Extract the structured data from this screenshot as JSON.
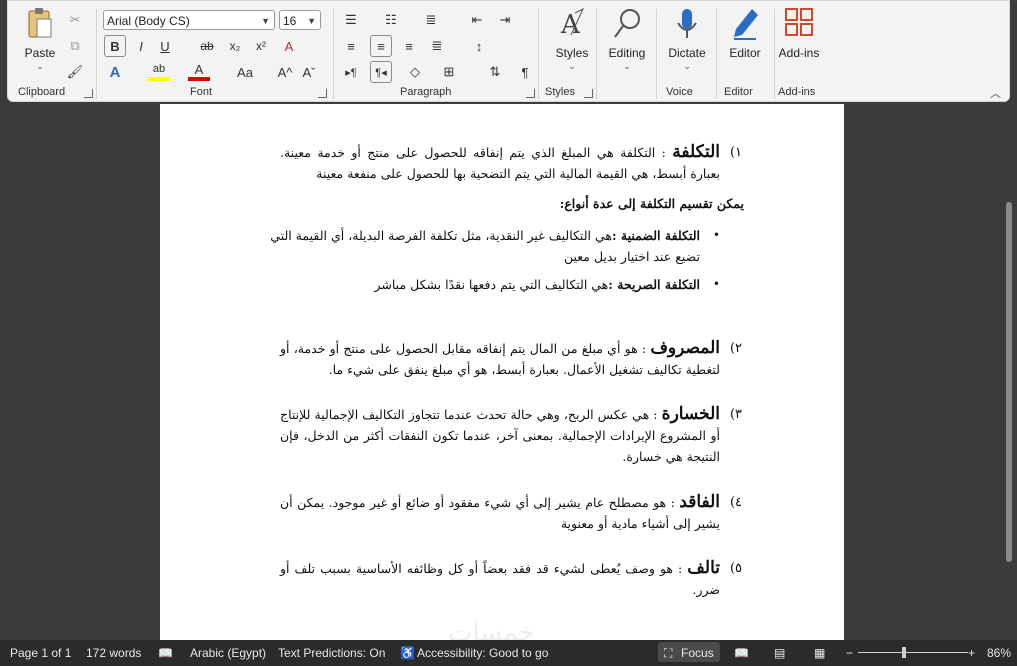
{
  "ribbon": {
    "clipboard": {
      "group_label": "Clipboard",
      "paste_label": "Paste"
    },
    "font": {
      "group_label": "Font",
      "font_name": "Arial (Body CS)",
      "font_size": "16",
      "bold": "B",
      "italic": "I",
      "underline": "U",
      "strike": "ab",
      "subscript": "x₂",
      "superscript": "x²",
      "clear_format": "A",
      "text_effects": "A",
      "highlight": "ab",
      "font_color": "A",
      "change_case": "Aa",
      "grow": "A^",
      "shrink": "Aˇ"
    },
    "paragraph": {
      "group_label": "Paragraph"
    },
    "styles": {
      "group_label": "Styles",
      "styles_label": "Styles"
    },
    "editing": {
      "label": "Editing"
    },
    "voice": {
      "group_label": "Voice",
      "dictate_label": "Dictate"
    },
    "editor": {
      "group_label": "Editor",
      "editor_label": "Editor"
    },
    "addins": {
      "group_label": "Add-ins",
      "addins_label": "Add-ins"
    }
  },
  "document": {
    "p1": {
      "num": "١)",
      "term": "التكلفة",
      "text": " : التكلفة هي المبلغ الذي يتم إنفاقه للحصول على منتج أو خدمة معينة. بعبارة أبسط، هي القيمة المالية التي يتم التضحية بها للحصول على منفعة معينة"
    },
    "subhead": "يمكن تقسيم التكلفة إلى عدة أنواع:",
    "b1": {
      "term": "التكلفة الضمنية :",
      "text": "هي التكاليف غير النقدية، مثل تكلفة الفرصة البديلة، أي القيمة التي تضيع عند اختيار بديل معين"
    },
    "b2": {
      "term": "التكلفة الصريحة :",
      "text": "هي التكاليف التي يتم دفعها نقدًا بشكل مباشر"
    },
    "p2": {
      "num": "٢)",
      "term": "المصروف",
      "text": " : هو أي مبلغ من المال يتم إنفاقه مقابل الحصول على منتج أو خدمة، أو لتغطية تكاليف تشغيل الأعمال. بعبارة أبسط، هو أي مبلغ ينفق على شيء ما."
    },
    "p3": {
      "num": "٣)",
      "term": "الخسارة",
      "text": " : هي عكس الربح، وهي حالة تحدث عندما تتجاوز التكاليف الإجمالية للإنتاج أو المشروع الإيرادات الإجمالية. بمعنى آخر، عندما تكون النفقات أكثر من الدخل، فإن النتيجة هي خسارة."
    },
    "p4": {
      "num": "٤)",
      "term": "الفاقد",
      "text": " : هو مصطلح عام يشير إلى أي شيء مفقود أو ضائع أو غير موجود. يمكن أن يشير إلى أشياء مادية أو معنوية"
    },
    "p5": {
      "num": "٥)",
      "term": "تالف",
      "text": " : هو وصف يُعطى لشيء قد فقد بعضاً أو كل وظائفه الأساسية بسبب تلف أو ضرر."
    }
  },
  "status": {
    "page": "Page 1 of 1",
    "words": "172 words",
    "language": "Arabic (Egypt)",
    "predictions": "Text Predictions: On",
    "accessibility": "Accessibility: Good to go",
    "focus": "Focus",
    "zoom": "86%"
  },
  "watermark": "خمسات",
  "colors": {
    "highlight": "#ffff00",
    "font_color": "#e00000",
    "addins": "#d04a2a",
    "editor_icon": "#2b6cc4"
  }
}
